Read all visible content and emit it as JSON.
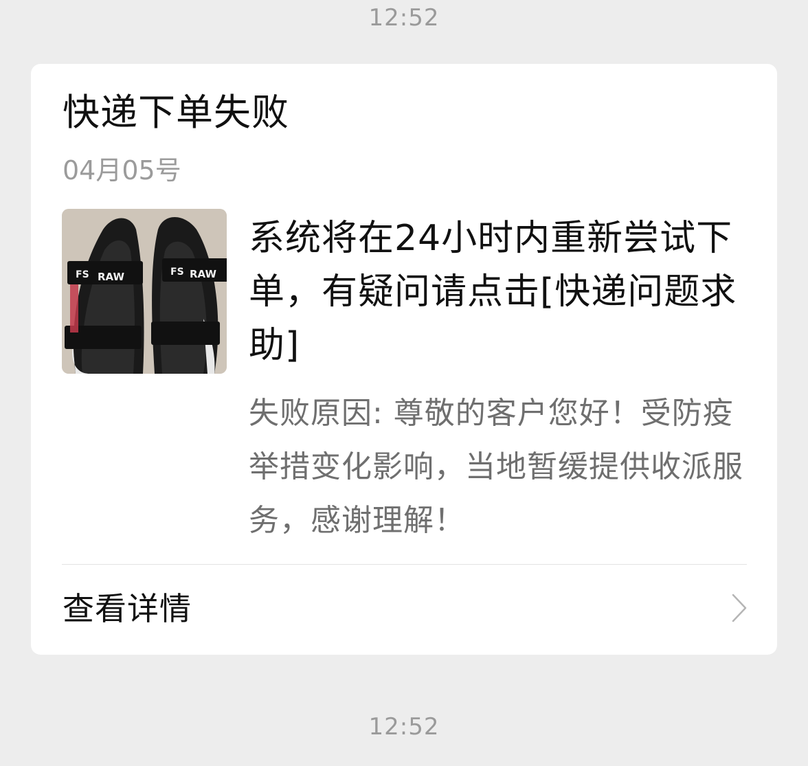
{
  "timestamps": {
    "top": "12:52",
    "bottom": "12:52"
  },
  "card": {
    "title": "快递下单失败",
    "date": "04月05号",
    "thumbnail": {
      "icon": "sandals-product-photo",
      "strap_text_left": "FS",
      "strap_text_right": "RAW"
    },
    "message": "系统将在24小时内重新尝试下单，有疑问请点击[快递问题求助]",
    "reason": "失败原因: 尊敬的客户您好！受防疫举措变化影响，当地暂缓提供收派服务，感谢理解！",
    "details_label": "查看详情",
    "details_icon": "chevron-right-icon"
  },
  "colors": {
    "background": "#ededed",
    "card": "#ffffff",
    "primary_text": "#111111",
    "secondary_text": "#6f6f6f",
    "timestamp_text": "#9a9a9a"
  }
}
